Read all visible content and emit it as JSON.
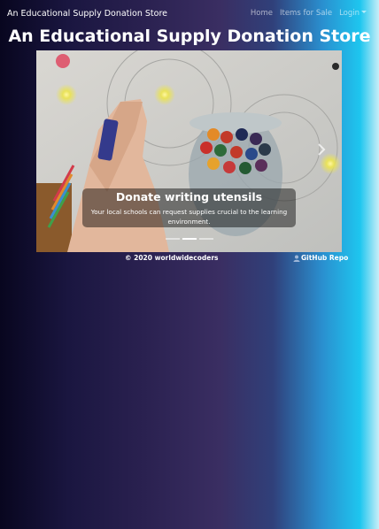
{
  "navbar": {
    "brand": "An Educational Supply Donation Store",
    "links": [
      "Home",
      "Items for Sale",
      "Login"
    ]
  },
  "page_title": "An Educational Supply Donation Store",
  "carousel": {
    "caption_title": "Donate writing utensils",
    "caption_text": "Your local schools can request supplies crucial to the learning environment.",
    "slide_count": 3,
    "active_slide": 2
  },
  "footer": {
    "copyright": "© 2020 worldwidecoders",
    "repo_link": "GitHub Repo"
  },
  "icons": [
    "chevron-down-icon",
    "chevron-right-icon",
    "user-icon"
  ]
}
